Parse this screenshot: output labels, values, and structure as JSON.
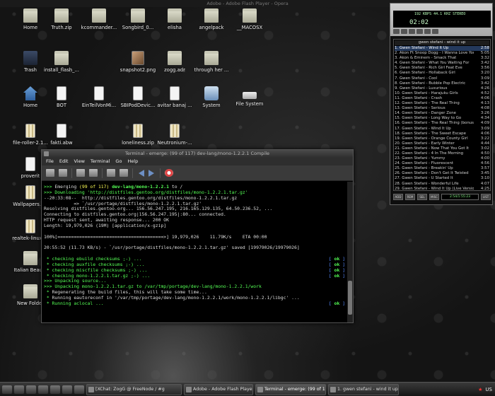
{
  "window_title": "Adobe - Adobe Flash Player - Opera",
  "desktop_icons": [
    {
      "label": "Home",
      "kind": "folder"
    },
    {
      "label": "Truth.zip",
      "kind": "folder"
    },
    {
      "label": "kcommander...",
      "kind": "folder"
    },
    {
      "label": "Songbird_0...",
      "kind": "folder"
    },
    {
      "label": "elisha",
      "kind": "folder"
    },
    {
      "label": "angelpack",
      "kind": "folder"
    },
    {
      "label": "__MACOSX",
      "kind": "folder"
    },
    {
      "label": "Trash",
      "kind": "trash"
    },
    {
      "label": "install_flash_...",
      "kind": "folder"
    },
    {
      "label": "snapshot2.png",
      "kind": "img"
    },
    {
      "label": "zogg.adr",
      "kind": "folder"
    },
    {
      "label": "through her ...",
      "kind": "folder"
    },
    {
      "label": "Home",
      "kind": "home"
    },
    {
      "label": "BOT",
      "kind": "file"
    },
    {
      "label": "EinTeilVonMi...",
      "kind": "music"
    },
    {
      "label": "SBIPodDevic...",
      "kind": "file"
    },
    {
      "label": "avitar banaj ...",
      "kind": "music"
    },
    {
      "label": "System",
      "kind": "sys"
    },
    {
      "label": "File System",
      "kind": "drive"
    },
    {
      "label": "file-roller-2.1...",
      "kind": "zip"
    },
    {
      "label": "fakti.abw",
      "kind": "file"
    },
    {
      "label": "loneliness.zip",
      "kind": "zip"
    },
    {
      "label": "Neutronium-...",
      "kind": "zip"
    },
    {
      "label": "proverit",
      "kind": "file"
    },
    {
      "label": "Wallpapers.zip",
      "kind": "zip"
    },
    {
      "label": "realtek-linux-...",
      "kind": "zip"
    },
    {
      "label": "Italian Beauty",
      "kind": "folder"
    },
    {
      "label": "New Folder",
      "kind": "folder"
    }
  ],
  "terminal": {
    "title": "Terminal - emerge: (99 of 117) dev-lang/mono-1.2.2.1 Compile",
    "menu": [
      "File",
      "Edit",
      "View",
      "Terminal",
      "Go",
      "Help"
    ],
    "lines": [
      {
        "p": ">>> ",
        "s": "Emerging ",
        "n": "(99 of 117) ",
        "pkg": "dev-lang/mono-1.2.2.1",
        "r": " to /"
      },
      {
        "t": ">>> Downloading 'http://distfiles.gentoo.org/distfiles/mono-1.2.2.1.tar.gz'"
      },
      {
        "t": "--20:33:08--  http://distfiles.gentoo.org/distfiles/mono-1.2.2.1.tar.gz"
      },
      {
        "t": "           => `/usr/portage/distfiles/mono-1.2.2.1.tar.gz'"
      },
      {
        "t": "Resolving distfiles.gentoo.org... 156.56.247.195, 216.165.129.135, 64.50.236.52, ..."
      },
      {
        "t": "Connecting to distfiles.gentoo.org|156.56.247.195|:80... connected."
      },
      {
        "t": "HTTP request sent, awaiting response... 200 OK"
      },
      {
        "t": "Length: 19,979,026 (19M) [application/x-gzip]"
      },
      {
        "t": ""
      },
      {
        "t": "100%[=======================================>] 19,979,026    11.79K/s    ETA 00:00"
      },
      {
        "t": ""
      },
      {
        "t": "20:55:52 (11.73 KB/s) - `/usr/portage/distfiles/mono-1.2.2.1.tar.gz' saved [19979026/19979026]"
      },
      {
        "t": ""
      },
      {
        "ok": " * checking ebuild checksums ;-) ..."
      },
      {
        "ok": " * checking auxfile checksums ;-) ..."
      },
      {
        "ok": " * checking miscfile checksums ;-) ..."
      },
      {
        "ok": " * checking mono-1.2.2.1.tar.gz ;-) ..."
      },
      {
        "t": ">>> Unpacking source..."
      },
      {
        "t": ">>> Unpacking mono-1.2.2.1.tar.gz to /var/tmp/portage/dev-lang/mono-1.2.2.1/work"
      },
      {
        "s2": " * ",
        "t": "Regenerating the build files, this will take some time..."
      },
      {
        "s2": " * ",
        "t": "Running eautoreconf in '/var/tmp/portage/dev-lang/mono-1.2.2.1/work/mono-1.2.2.1/libgc' ..."
      },
      {
        "ok": " * Running aclocal ..."
      }
    ],
    "ok_label": "ok"
  },
  "player": {
    "time": "02:02",
    "bitrate": "192 KBPS  44.1 KHZ  STEREO",
    "playlist_title": "gwen stefani - wind it up",
    "total_time": "2:54/1:55:23",
    "buttons": [
      "ADD",
      "REM",
      "SEL",
      "MISC",
      "LIST"
    ],
    "tracks": [
      {
        "t": "1. Gwen Stefani - Wind It Up",
        "d": "2:58",
        "sel": true
      },
      {
        "t": "2. Akon Ft Snoop Dogg - I Wanna Love You",
        "d": "5:05"
      },
      {
        "t": "3. Akon & Eminem - Smack That",
        "d": "3:32"
      },
      {
        "t": "4. Gwen Stefani - What You Waiting For",
        "d": "3:42"
      },
      {
        "t": "5. Gwen Stefani - Rich Girl Feat Eve",
        "d": "3:56"
      },
      {
        "t": "6. Gwen Stefani - Hollaback Girl",
        "d": "3:20"
      },
      {
        "t": "7. Gwen Stefani - Cool",
        "d": "3:09"
      },
      {
        "t": "8. Gwen Stefani - Bubble Pop Electric",
        "d": "3:42"
      },
      {
        "t": "9. Gwen Stefani - Luxurious",
        "d": "4:26"
      },
      {
        "t": "10. Gwen Stefani - Harajuku Girls",
        "d": "4:52"
      },
      {
        "t": "11. Gwen Stefani - Crash",
        "d": "4:06"
      },
      {
        "t": "12. Gwen Stefani - The Real Thing",
        "d": "4:13"
      },
      {
        "t": "13. Gwen Stefani - Serious",
        "d": "4:08"
      },
      {
        "t": "14. Gwen Stefani - Danger Zone",
        "d": "3:26"
      },
      {
        "t": "15. Gwen Stefani - Long Way to Go",
        "d": "4:34"
      },
      {
        "t": "16. Gwen Stefani - The Real Thing (bonus)",
        "d": "4:09"
      },
      {
        "t": "17. Gwen Stefani - Wind It Up",
        "d": "3:09"
      },
      {
        "t": "18. Gwen Stefani - The Sweet Escape",
        "d": "4:06"
      },
      {
        "t": "19. Gwen Stefani - Orange County Girl",
        "d": "3:22"
      },
      {
        "t": "20. Gwen Stefani - Early Winter",
        "d": "4:44"
      },
      {
        "t": "21. Gwen Stefani - Now That You Got It",
        "d": "3:02"
      },
      {
        "t": "22. Gwen Stefani - 4 In The Morning",
        "d": "4:50"
      },
      {
        "t": "23. Gwen Stefani - Yummy",
        "d": "4:00"
      },
      {
        "t": "24. Gwen Stefani - Fluorescent",
        "d": "4:56"
      },
      {
        "t": "25. Gwen Stefani - Breakin' Up",
        "d": "3:57"
      },
      {
        "t": "26. Gwen Stefani - Don't Get It Twisted",
        "d": "3:45"
      },
      {
        "t": "27. Gwen Stefani - U Started It",
        "d": "3:10"
      },
      {
        "t": "28. Gwen Stefani - Wonderful Life",
        "d": "4:07"
      },
      {
        "t": "29. Gwen Stefani - Wind It Up (Live Version)",
        "d": "4:25"
      }
    ]
  },
  "taskbar": {
    "tasks": [
      "[XChat: ZogG @ FreeNode / #g",
      "Adobe - Adobe Flash Player - Ope",
      "Terminal - emerge: (99 of 117)",
      "1. gwen stefani - wind it up (2:5"
    ],
    "locale": "US"
  }
}
